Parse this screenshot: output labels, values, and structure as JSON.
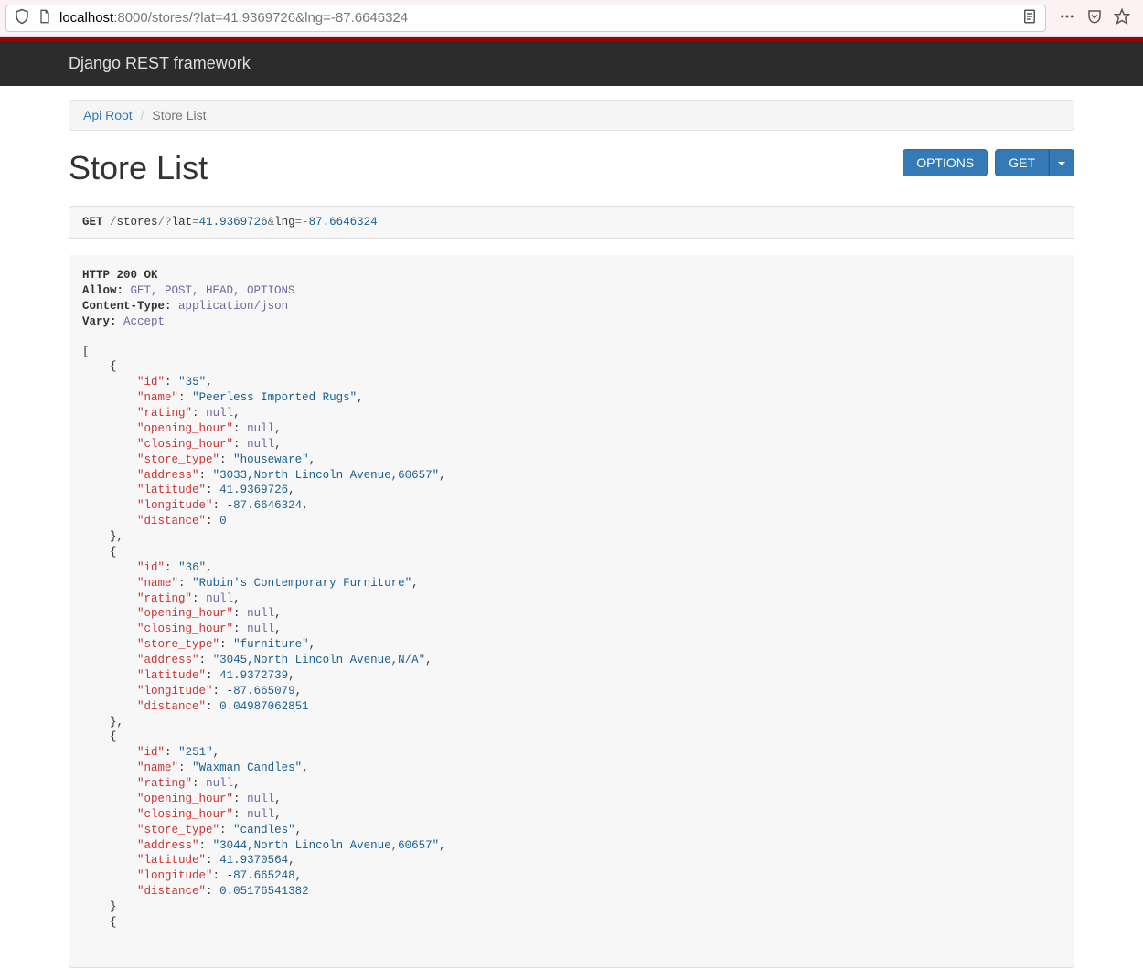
{
  "browser": {
    "url_host": "localhost",
    "url_rest": ":8000/stores/?lat=41.9369726&lng=-87.6646324"
  },
  "navbar": {
    "brand": "Django REST framework"
  },
  "breadcrumb": {
    "root": "Api Root",
    "current": "Store List"
  },
  "page": {
    "title": "Store List",
    "options_label": "OPTIONS",
    "get_label": "GET"
  },
  "request": {
    "method": "GET",
    "path_prefix": "/",
    "path_stores": "stores",
    "path_slash_q": "/?",
    "lat_key": "lat",
    "eq": "=",
    "lat_val": "41.9369726",
    "amp": "&",
    "lng_key": "lng",
    "neg": "=-",
    "lng_val": "87.6646324"
  },
  "response": {
    "status_line": "HTTP 200 OK",
    "headers": {
      "allow_k": "Allow:",
      "allow_v": "GET, POST, HEAD, OPTIONS",
      "ctype_k": "Content-Type:",
      "ctype_v": "application/json",
      "vary_k": "Vary:",
      "vary_v": "Accept"
    },
    "body": [
      {
        "id": "35",
        "name": "Peerless Imported Rugs",
        "rating": null,
        "opening_hour": null,
        "closing_hour": null,
        "store_type": "houseware",
        "address": "3033,North Lincoln Avenue,60657",
        "latitude": 41.9369726,
        "longitude": -87.6646324,
        "distance": 0.0
      },
      {
        "id": "36",
        "name": "Rubin's Contemporary Furniture",
        "rating": null,
        "opening_hour": null,
        "closing_hour": null,
        "store_type": "furniture",
        "address": "3045,North Lincoln Avenue,N/A",
        "latitude": 41.9372739,
        "longitude": -87.665079,
        "distance": 0.04987062851
      },
      {
        "id": "251",
        "name": "Waxman Candles",
        "rating": null,
        "opening_hour": null,
        "closing_hour": null,
        "store_type": "candles",
        "address": "3044,North Lincoln Avenue,60657",
        "latitude": 41.9370564,
        "longitude": -87.665248,
        "distance": 0.05176541382
      }
    ]
  }
}
